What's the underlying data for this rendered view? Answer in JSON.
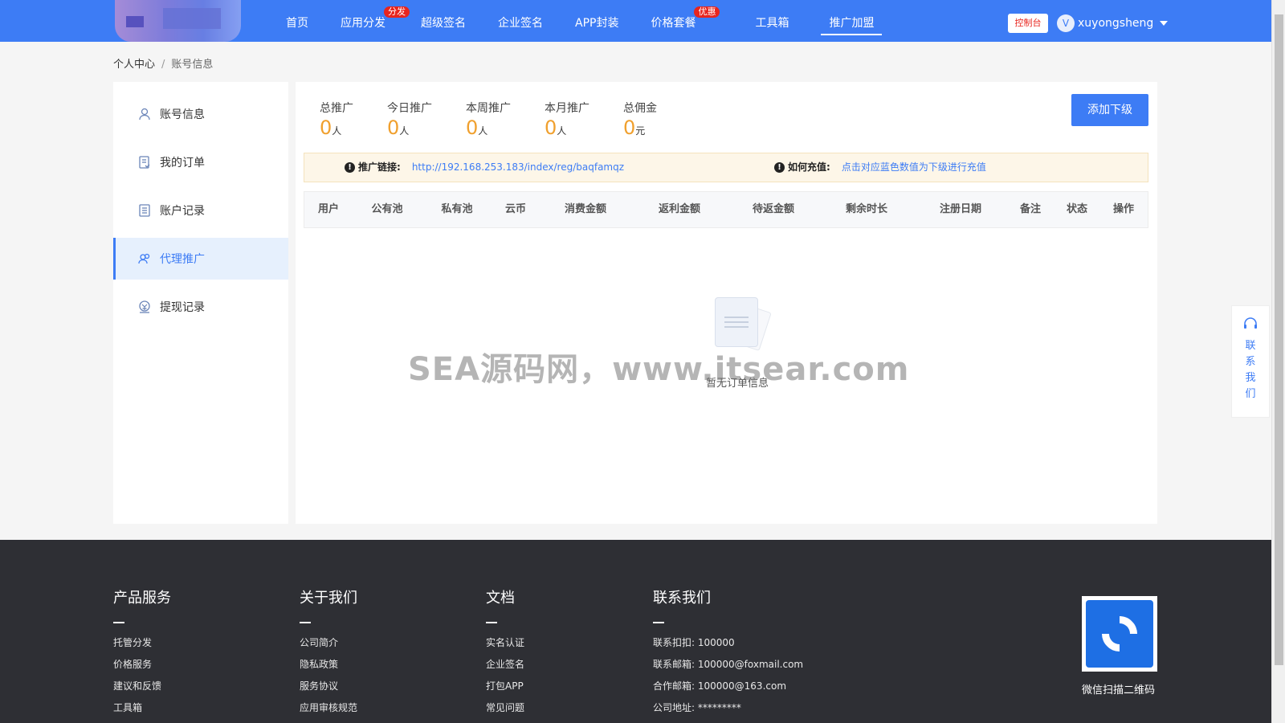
{
  "header": {
    "nav": [
      {
        "label": "首页",
        "badge": ""
      },
      {
        "label": "应用分发",
        "badge": "分发"
      },
      {
        "label": "超级签名",
        "badge": ""
      },
      {
        "label": "企业签名",
        "badge": ""
      },
      {
        "label": "APP封装",
        "badge": ""
      },
      {
        "label": "价格套餐",
        "badge": "优惠"
      },
      {
        "label": "工具箱",
        "badge": ""
      },
      {
        "label": "推广加盟",
        "badge": ""
      }
    ],
    "console_label": "控制台",
    "avatar_letter": "V",
    "username": "xuyongsheng"
  },
  "breadcrumb": {
    "root": "个人中心",
    "sep": "/",
    "current": "账号信息"
  },
  "sidebar": {
    "items": [
      {
        "label": "账号信息",
        "icon": "user-icon"
      },
      {
        "label": "我的订单",
        "icon": "order-icon"
      },
      {
        "label": "账户记录",
        "icon": "record-icon"
      },
      {
        "label": "代理推广",
        "icon": "agent-icon"
      },
      {
        "label": "提现记录",
        "icon": "withdraw-icon"
      }
    ],
    "active_index": 3
  },
  "stats": [
    {
      "label": "总推广",
      "value": "0",
      "unit": "人"
    },
    {
      "label": "今日推广",
      "value": "0",
      "unit": "人"
    },
    {
      "label": "本周推广",
      "value": "0",
      "unit": "人"
    },
    {
      "label": "本月推广",
      "value": "0",
      "unit": "人"
    },
    {
      "label": "总佣金",
      "value": "0",
      "unit": "元"
    }
  ],
  "add_button": "添加下级",
  "notice": {
    "link_label": "推广链接:",
    "link_value": "http://192.168.253.183/index/reg/baqfamqz",
    "recharge_label": "如何充值:",
    "recharge_value": "点击对应蓝色数值为下级进行充值"
  },
  "table": {
    "columns": [
      "用户",
      "公有池",
      "私有池",
      "云币",
      "消费金额",
      "返利金额",
      "待返金额",
      "剩余时长",
      "注册日期",
      "备注",
      "状态",
      "操作"
    ],
    "empty_text": "暂无订单信息"
  },
  "watermark": "SEA源码网，www.itsear.com",
  "contact": {
    "label": "联系我们"
  },
  "footer": {
    "columns": [
      {
        "title": "产品服务",
        "links": [
          "托管分发",
          "价格服务",
          "建议和反馈",
          "工具箱"
        ]
      },
      {
        "title": "关于我们",
        "links": [
          "公司简介",
          "隐私政策",
          "服务协议",
          "应用审核规范"
        ]
      },
      {
        "title": "文档",
        "links": [
          "实名认证",
          "企业签名",
          "打包APP",
          "常见问题"
        ]
      },
      {
        "title": "联系我们",
        "links": [
          "联系扣扣:  100000",
          "联系邮箱:  100000@foxmail.com",
          "合作邮箱:  100000@163.com",
          "公司地址:  *********"
        ]
      }
    ],
    "qr_label": "微信扫描二维码"
  },
  "colors": {
    "primary": "#3d7cf5",
    "accent_number": "#f0a02e",
    "badge": "#e8251e",
    "footer_bg": "#2e2f34"
  }
}
